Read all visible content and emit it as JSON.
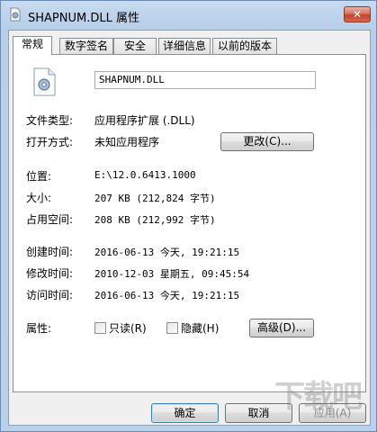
{
  "window": {
    "title": "SHAPNUM.DLL 属性",
    "close_label": "✕"
  },
  "tabs": [
    {
      "label": "常规",
      "active": true
    },
    {
      "label": "数字签名",
      "active": false
    },
    {
      "label": "安全",
      "active": false
    },
    {
      "label": "详细信息",
      "active": false
    },
    {
      "label": "以前的版本",
      "active": false
    }
  ],
  "general": {
    "filename": "SHAPNUM.DLL",
    "file_type_label": "文件类型:",
    "file_type_value": "应用程序扩展 (.DLL)",
    "opens_with_label": "打开方式:",
    "opens_with_value": "未知应用程序",
    "change_button": "更改(C)...",
    "location_label": "位置:",
    "location_value": "E:\\12.0.6413.1000",
    "size_label": "大小:",
    "size_value": "207 KB (212,824 字节)",
    "size_on_disk_label": "占用空间:",
    "size_on_disk_value": "208 KB (212,992 字节)",
    "created_label": "创建时间:",
    "created_value": "2016-06-13 今天, 19:21:15",
    "modified_label": "修改时间:",
    "modified_value": "2010-12-03 星期五, 09:45:54",
    "accessed_label": "访问时间:",
    "accessed_value": "2016-06-13 今天, 19:21:15",
    "attributes_label": "属性:",
    "readonly_label": "只读(R)",
    "hidden_label": "隐藏(H)",
    "advanced_button": "高级(D)..."
  },
  "footer": {
    "ok": "确定",
    "cancel": "取消",
    "apply": "应用(A)"
  },
  "watermark": "下载吧",
  "colors": {
    "titlebar": "#b9d1ea",
    "close": "#c24029",
    "panel": "#ffffff"
  }
}
